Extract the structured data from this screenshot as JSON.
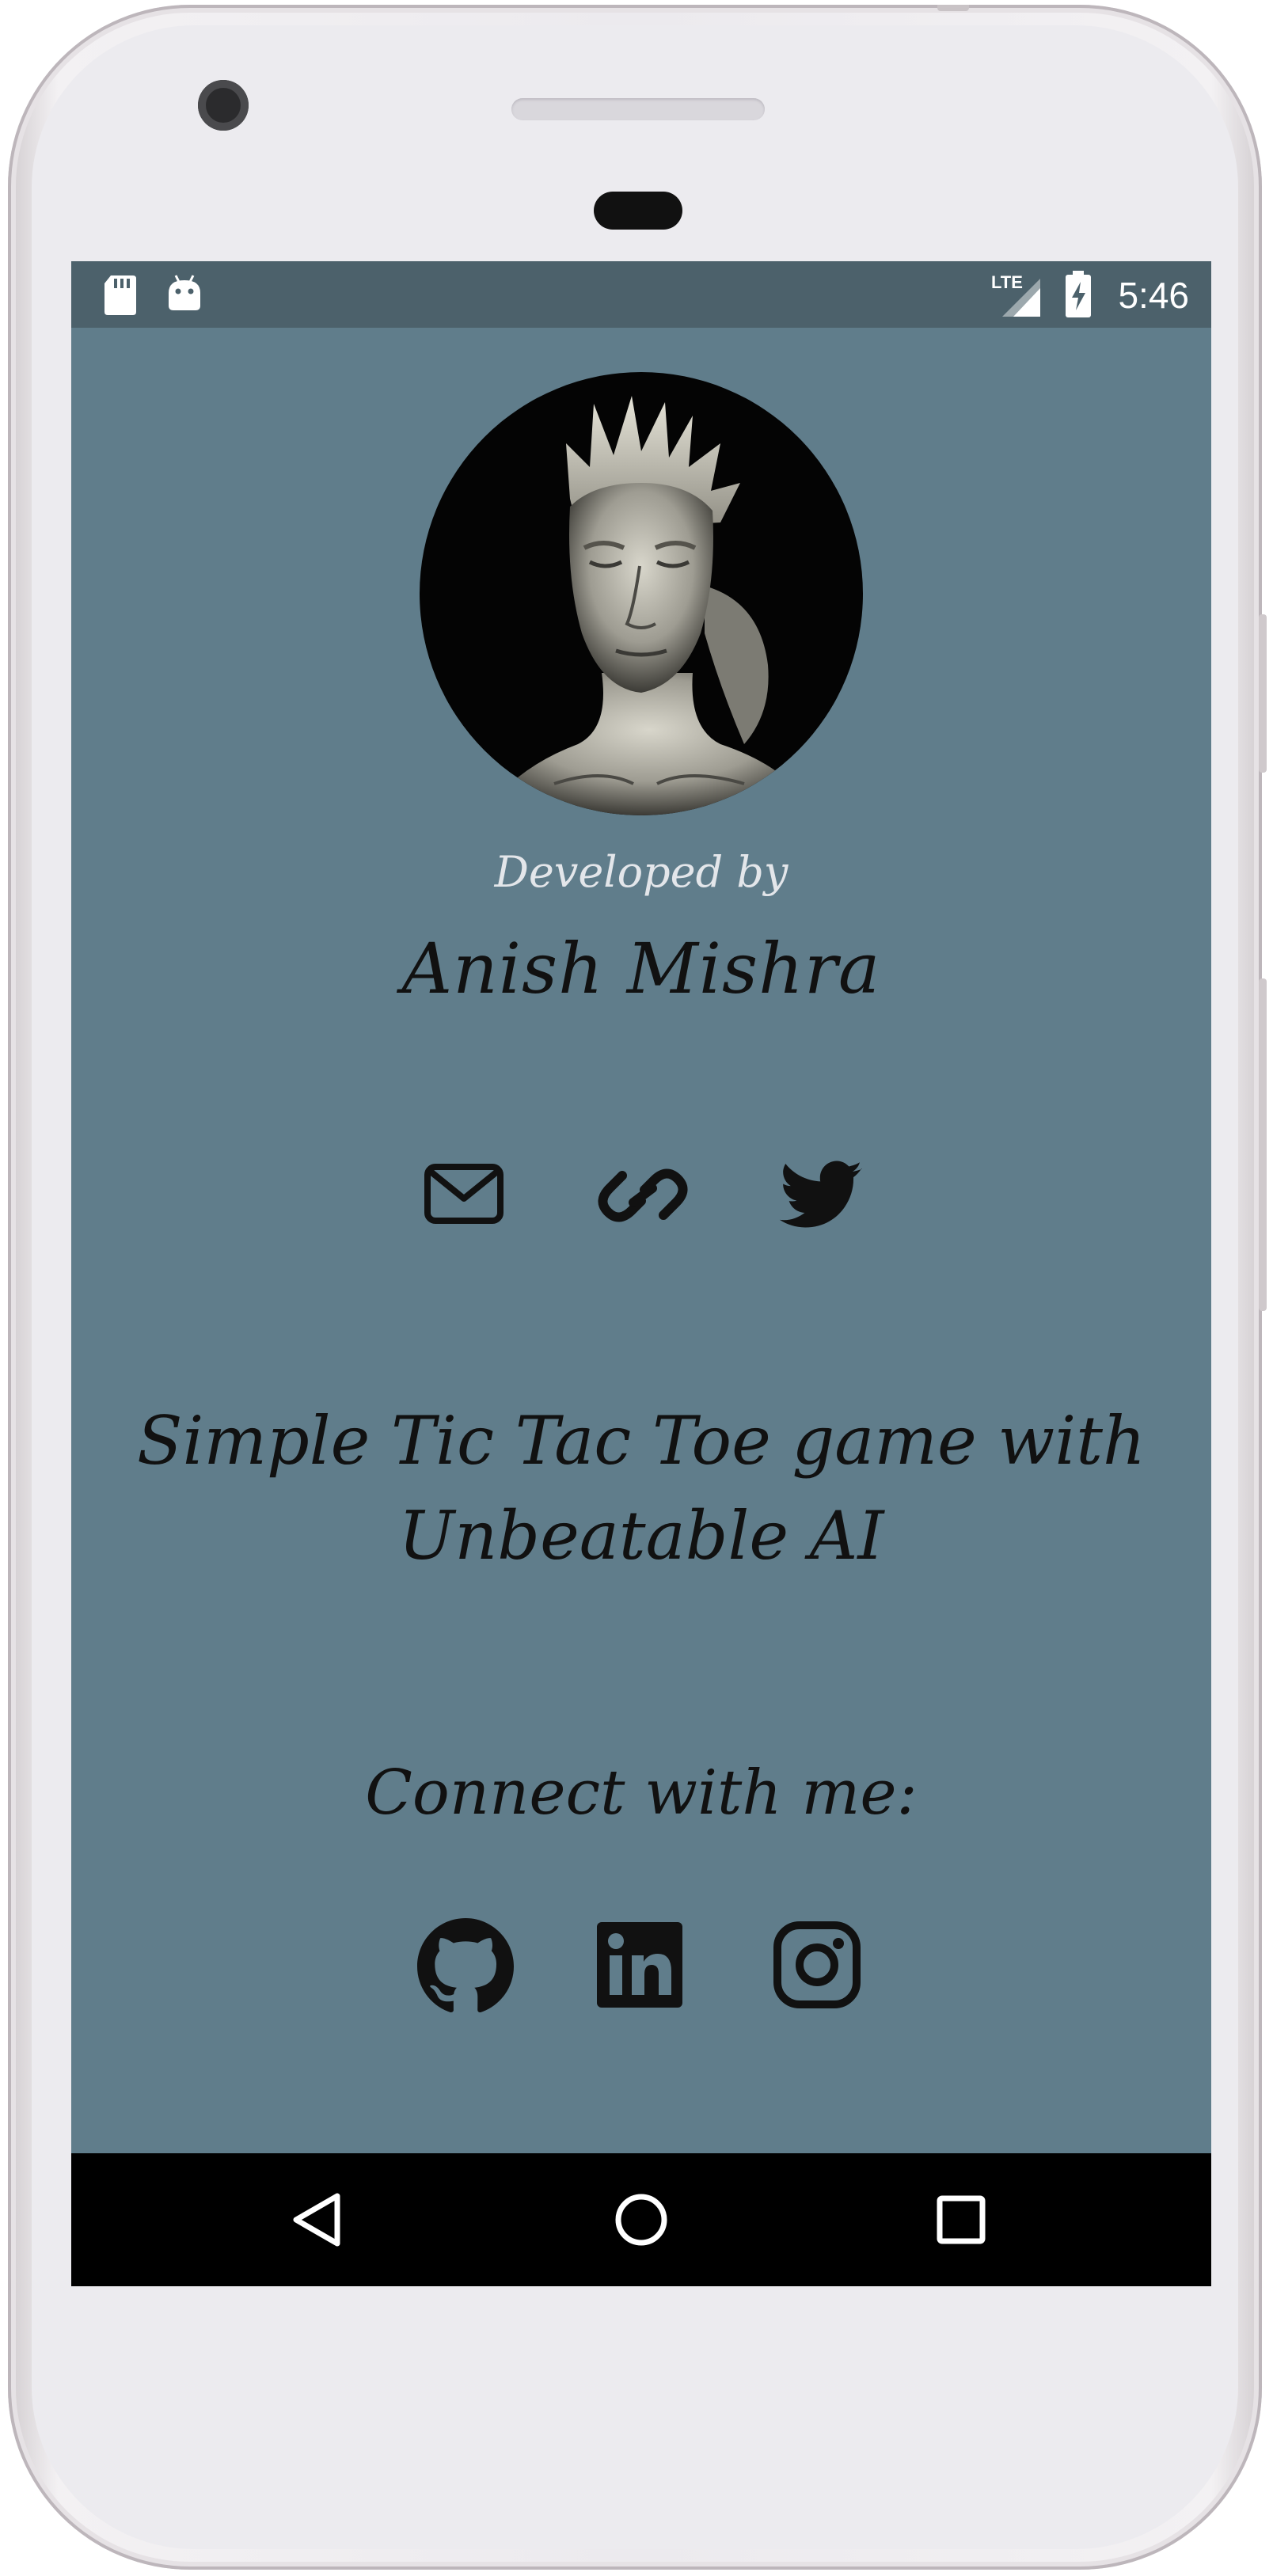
{
  "status_bar": {
    "time": "5:46",
    "network": "LTE",
    "left_icons": [
      "sd-card-icon",
      "android-icon"
    ],
    "right_icons": [
      "lte-signal-icon",
      "battery-charging-icon"
    ]
  },
  "profile": {
    "developed_by_label": "Developed by",
    "developer_name": "Anish Mishra"
  },
  "contact_icons": [
    "mail-icon",
    "link-icon",
    "twitter-icon"
  ],
  "tagline": "Simple Tic Tac Toe game with Unbeatable AI",
  "connect": {
    "heading": "Connect with me:",
    "icons": [
      "github-icon",
      "linkedin-icon",
      "instagram-icon"
    ]
  },
  "nav_bar": {
    "buttons": [
      "back-button",
      "home-button",
      "recents-button"
    ]
  },
  "colors": {
    "screen_bg": "#607d8b",
    "status_bar_bg": "#4c616b",
    "nav_bar_bg": "#000000",
    "text_dark": "#111111",
    "text_light": "#e3e6ea"
  }
}
